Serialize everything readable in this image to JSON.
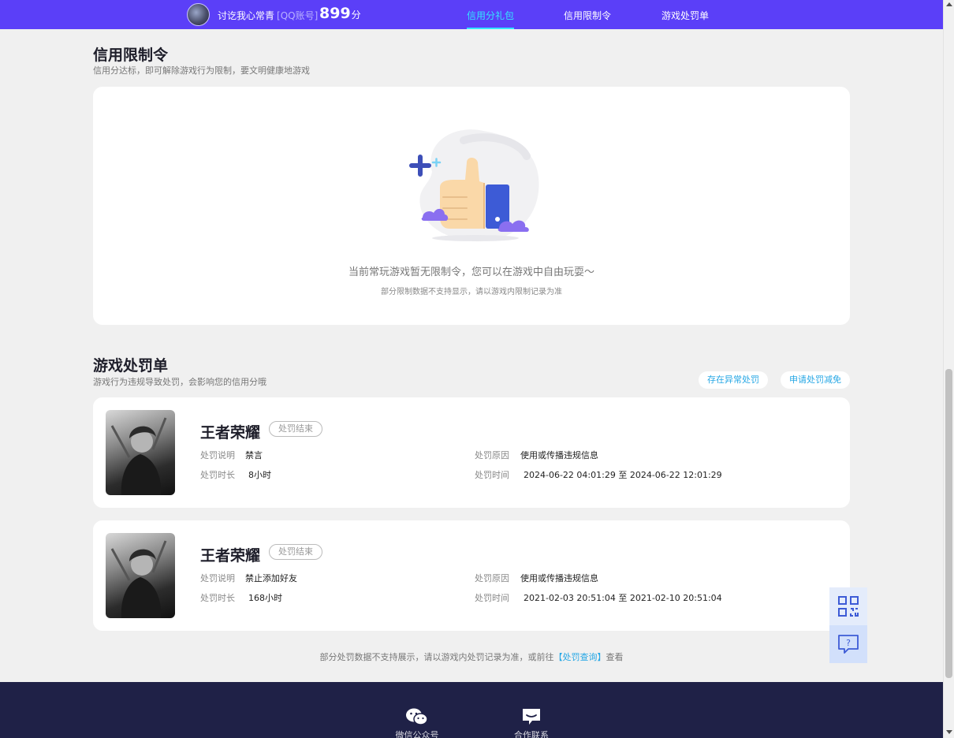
{
  "header": {
    "username": "讨讫我心常青",
    "account_type": "[QQ账号]",
    "score": "899",
    "score_unit": "分",
    "tabs": [
      {
        "label": "信用分礼包",
        "active": true
      },
      {
        "label": "信用限制令",
        "active": false
      },
      {
        "label": "游戏处罚单",
        "active": false
      }
    ]
  },
  "restriction": {
    "title": "信用限制令",
    "subtitle": "信用分达标，即可解除游戏行为限制，要文明健康地游戏",
    "empty_message": "当前常玩游戏暂无限制令，您可以在游戏中自由玩耍～",
    "empty_note": "部分限制数据不支持显示，请以游戏内限制记录为准"
  },
  "penalty": {
    "title": "游戏处罚单",
    "subtitle": "游戏行为违规导致处罚，会影响您的信用分哦",
    "abnormal_button": "存在异常处罚",
    "appeal_button": "申请处罚减免",
    "labels": {
      "description": "处罚说明",
      "duration": "处罚时长",
      "reason": "处罚原因",
      "time": "处罚时间"
    },
    "items": [
      {
        "game": "王者荣耀",
        "status": "处罚结束",
        "description": "禁言",
        "duration": "8小时",
        "reason": "使用或传播违规信息",
        "time": "2024-06-22 04:01:29 至 2024-06-22 12:01:29"
      },
      {
        "game": "王者荣耀",
        "status": "处罚结束",
        "description": "禁止添加好友",
        "duration": "168小时",
        "reason": "使用或传播违规信息",
        "time": "2021-02-03 20:51:04 至 2021-02-10 20:51:04"
      }
    ],
    "footnote_before": "部分处罚数据不支持展示，请以游戏内处罚记录为准，或前往",
    "footnote_link": "【处罚查询】",
    "footnote_after": "查看"
  },
  "footer": {
    "items": [
      {
        "label": "微信公众号",
        "icon": "wechat-icon"
      },
      {
        "label": "合作联系",
        "icon": "message-icon"
      }
    ]
  },
  "colors": {
    "brand": "#5b3ff8",
    "active_tab": "#33e6ff",
    "link": "#26a7e5",
    "footer": "#1f2147",
    "illustration_blue": "#3d5bd6",
    "illustration_purple": "#8a6ff0"
  }
}
